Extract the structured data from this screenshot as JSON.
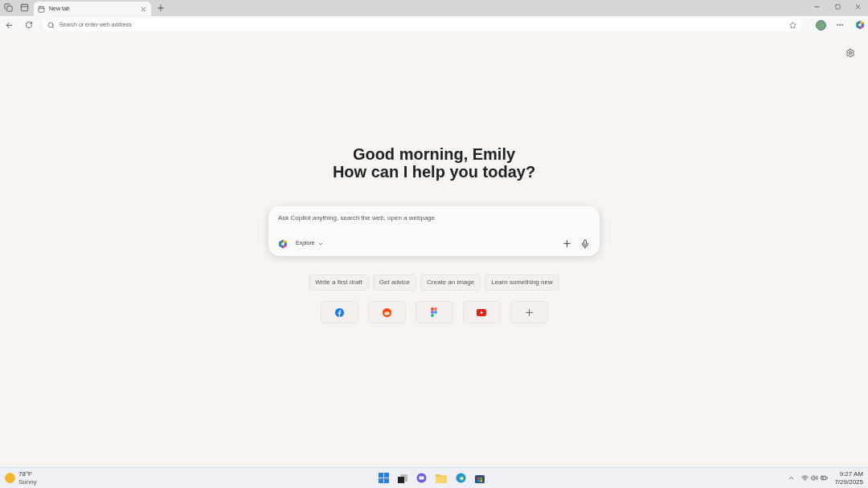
{
  "tab": {
    "title": "New tab",
    "selected": true
  },
  "address_bar": {
    "placeholder": "Search or enter web address"
  },
  "greeting": {
    "line_1": "Good morning, Emily",
    "line_2": "How can I help you today?"
  },
  "copilot_box": {
    "placeholder": "Ask Copilot anything, search the web, open a webpage",
    "mode": "Explore"
  },
  "suggestions": [
    "Write a first draft",
    "Get advice",
    "Create an image",
    "Learn something new"
  ],
  "shortcuts": [
    {
      "kind": "facebook"
    },
    {
      "kind": "reddit"
    },
    {
      "kind": "figma"
    },
    {
      "kind": "youtube"
    },
    {
      "kind": "add"
    }
  ],
  "taskbar": {
    "weather": {
      "temperature": "78°F",
      "condition": "Sunny"
    },
    "clock": {
      "time": "9:27 AM",
      "date": "7/29/2025"
    }
  }
}
